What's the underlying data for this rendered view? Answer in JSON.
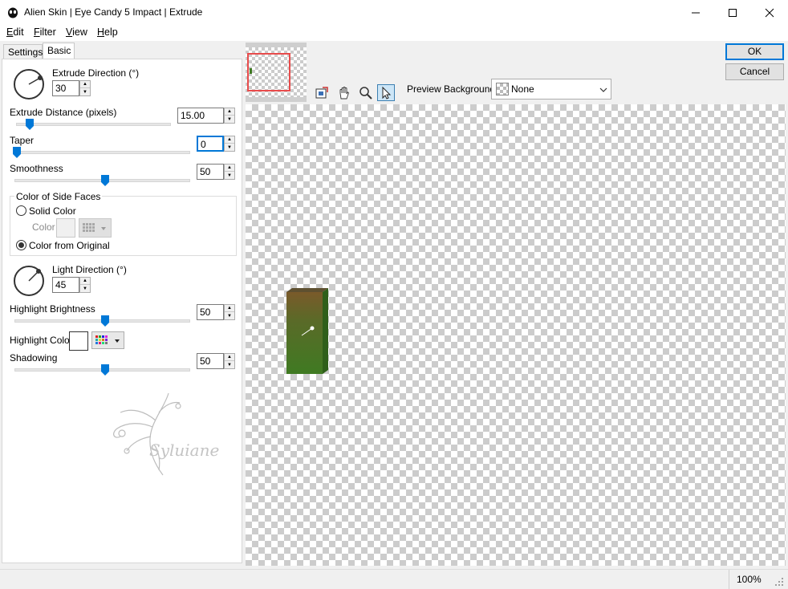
{
  "window": {
    "title": "Alien Skin | Eye Candy 5 Impact | Extrude"
  },
  "menu": [
    {
      "key": "E",
      "rest": "dit"
    },
    {
      "key": "F",
      "rest": "ilter"
    },
    {
      "key": "V",
      "rest": "iew"
    },
    {
      "key": "H",
      "rest": "elp"
    }
  ],
  "tabs": {
    "settings": "Settings",
    "basic": "Basic"
  },
  "controls": {
    "extrude_direction": {
      "label": "Extrude Direction (°)",
      "value": "30"
    },
    "extrude_distance": {
      "label": "Extrude Distance (pixels)",
      "value": "15.00"
    },
    "taper": {
      "label": "Taper",
      "value": "0"
    },
    "smoothness": {
      "label": "Smoothness",
      "value": "50"
    },
    "side_faces": {
      "title": "Color of Side Faces",
      "solid": "Solid Color",
      "color": "Color",
      "original": "Color from Original",
      "selected": "Color from Original"
    },
    "light_direction": {
      "label": "Light Direction (°)",
      "value": "45"
    },
    "highlight_brightness": {
      "label": "Highlight Brightness",
      "value": "50"
    },
    "highlight_color": {
      "label": "Highlight Color"
    },
    "shadowing": {
      "label": "Shadowing",
      "value": "50"
    }
  },
  "slider_levels": {
    "extrude_distance": 0.07,
    "taper": 0.0,
    "smoothness": 0.5,
    "highlight_brightness": 0.5,
    "shadowing": 0.5
  },
  "buttons": {
    "ok": "OK",
    "cancel": "Cancel"
  },
  "preview": {
    "background_label": "Preview Background:",
    "background_value": "None"
  },
  "status": {
    "zoom": "100%"
  },
  "watermark": {
    "text": "Syluiane"
  },
  "colors": {
    "accent": "#0078d7",
    "object_top": "#7a5a2a",
    "object_face": "#3f7a22",
    "nav_frame": "#e84c4c"
  },
  "icons": [
    "app-icon",
    "minimize-icon",
    "maximize-icon",
    "close-icon",
    "navigator-icon",
    "hand-icon",
    "zoom-icon",
    "arrow-icon"
  ]
}
